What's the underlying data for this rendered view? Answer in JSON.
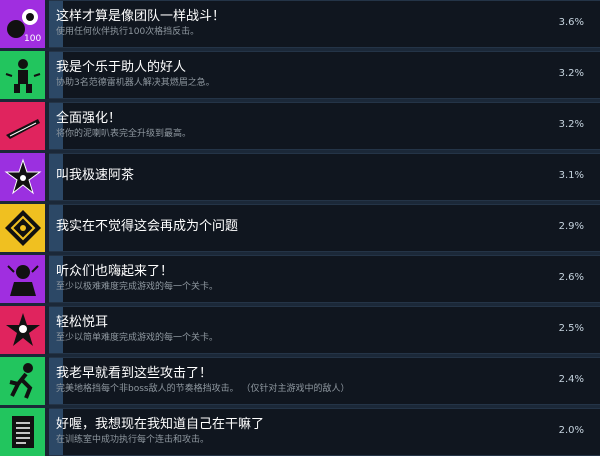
{
  "achievements": [
    {
      "title": "这样才算是像团队一样战斗！",
      "desc": "使用任何伙伴执行100次格挡反击。",
      "percent": "3.6%",
      "percent_value": 3.6,
      "icon": "team-fight-icon",
      "color": "#a02ee0"
    },
    {
      "title": "我是个乐于助人的好人",
      "desc": "协助3名范德雷机器人解决其燃眉之急。",
      "percent": "3.2%",
      "percent_value": 3.2,
      "icon": "helper-robot-icon",
      "color": "#22c55e"
    },
    {
      "title": "全面强化！",
      "desc": "将你的泥喇叭表完全升级到最高。",
      "percent": "3.2%",
      "percent_value": 3.2,
      "icon": "guitar-icon",
      "color": "#e0245e"
    },
    {
      "title": "叫我极速阿茶",
      "desc": "",
      "percent": "3.1%",
      "percent_value": 3.1,
      "icon": "speed-star-icon",
      "color": "#9b30e0"
    },
    {
      "title": "我实在不觉得这会再成为个问题",
      "desc": "",
      "percent": "2.9%",
      "percent_value": 2.9,
      "icon": "diamond-emblem-icon",
      "color": "#f0c020"
    },
    {
      "title": "听众们也嗨起来了！",
      "desc": "至少以极难难度完成游戏的每一个关卡。",
      "percent": "2.6%",
      "percent_value": 2.6,
      "icon": "audience-icon",
      "color": "#a02ee0"
    },
    {
      "title": "轻松悦耳",
      "desc": "至少以简单难度完成游戏的每一个关卡。",
      "percent": "2.5%",
      "percent_value": 2.5,
      "icon": "easy-star-icon",
      "color": "#e0245e"
    },
    {
      "title": "我老早就看到这些攻击了！",
      "desc": "完美地格挡每个非boss敌人的节奏格挡攻击。  （仅针对主游戏中的敌人）",
      "percent": "2.4%",
      "percent_value": 2.4,
      "icon": "runner-icon",
      "color": "#22c55e"
    },
    {
      "title": "好喔，我想现在我知道自己在干嘛了",
      "desc": "在训练室中成功执行每个连击和攻击。",
      "percent": "2.0%",
      "percent_value": 2.0,
      "icon": "notepad-icon",
      "color": "#22c55e"
    }
  ]
}
